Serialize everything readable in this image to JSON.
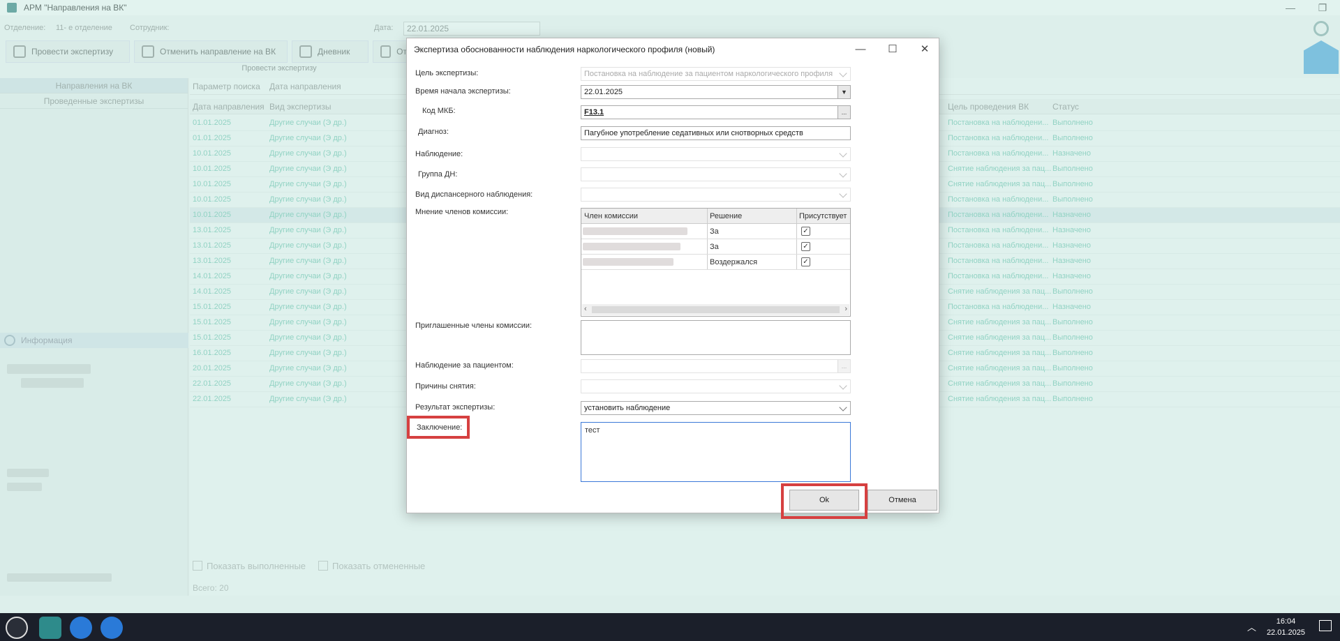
{
  "app": {
    "title": "АРМ \"Направления на ВК\"",
    "dept_label": "Отделение:",
    "dept_value": "11- е отделение",
    "employee_label": "Сотрудник:",
    "date_label": "Дата:",
    "date_value": "22.01.2025"
  },
  "toolbar": {
    "btn1": "Провести экспертизу",
    "btn2": "Отменить направление на ВК",
    "btn3": "Дневник",
    "btn4": "От",
    "caption": "Провести экспертизу"
  },
  "left_panel": {
    "tab1": "Направления на ВК",
    "tab2": "Проведенные экспертизы",
    "info": "Информация"
  },
  "grid": {
    "filter_param": "Параметр поиска",
    "filter_value": "Дата направления",
    "columns": {
      "date": "Дата направления",
      "type": "Вид экспертизы",
      "goal": "Цель проведения ВК",
      "status": "Статус"
    },
    "rows": [
      {
        "date": "01.01.2025",
        "type": "Другие случаи (Э др.)",
        "goal": "Постановка на наблюдени...",
        "status": "Выполнено"
      },
      {
        "date": "01.01.2025",
        "type": "Другие случаи (Э др.)",
        "goal": "Постановка на наблюдени...",
        "status": "Выполнено"
      },
      {
        "date": "10.01.2025",
        "type": "Другие случаи (Э др.)",
        "goal": "Постановка на наблюдени...",
        "status": "Назначено"
      },
      {
        "date": "10.01.2025",
        "type": "Другие случаи (Э др.)",
        "goal": "Снятие наблюдения за пац...",
        "status": "Выполнено"
      },
      {
        "date": "10.01.2025",
        "type": "Другие случаи (Э др.)",
        "goal": "Снятие наблюдения за пац...",
        "status": "Выполнено"
      },
      {
        "date": "10.01.2025",
        "type": "Другие случаи (Э др.)",
        "goal": "Постановка на наблюдени...",
        "status": "Выполнено"
      },
      {
        "date": "10.01.2025",
        "type": "Другие случаи (Э др.)",
        "goal": "Постановка на наблюдени...",
        "status": "Назначено"
      },
      {
        "date": "13.01.2025",
        "type": "Другие случаи (Э др.)",
        "goal": "Постановка на наблюдени...",
        "status": "Назначено"
      },
      {
        "date": "13.01.2025",
        "type": "Другие случаи (Э др.)",
        "goal": "Постановка на наблюдени...",
        "status": "Назначено"
      },
      {
        "date": "13.01.2025",
        "type": "Другие случаи (Э др.)",
        "goal": "Постановка на наблюдени...",
        "status": "Назначено"
      },
      {
        "date": "14.01.2025",
        "type": "Другие случаи (Э др.)",
        "goal": "Постановка на наблюдени...",
        "status": "Назначено"
      },
      {
        "date": "14.01.2025",
        "type": "Другие случаи (Э др.)",
        "goal": "Снятие наблюдения за пац...",
        "status": "Выполнено"
      },
      {
        "date": "15.01.2025",
        "type": "Другие случаи (Э др.)",
        "goal": "Постановка на наблюдени...",
        "status": "Назначено"
      },
      {
        "date": "15.01.2025",
        "type": "Другие случаи (Э др.)",
        "goal": "Снятие наблюдения за пац...",
        "status": "Выполнено"
      },
      {
        "date": "15.01.2025",
        "type": "Другие случаи (Э др.)",
        "goal": "Снятие наблюдения за пац...",
        "status": "Выполнено"
      },
      {
        "date": "16.01.2025",
        "type": "Другие случаи (Э др.)",
        "goal": "Снятие наблюдения за пац...",
        "status": "Выполнено"
      },
      {
        "date": "20.01.2025",
        "type": "Другие случаи (Э др.)",
        "goal": "Снятие наблюдения за пац...",
        "status": "Выполнено"
      },
      {
        "date": "22.01.2025",
        "type": "Другие случаи (Э др.)",
        "goal": "Снятие наблюдения за пац...",
        "status": "Выполнено"
      },
      {
        "date": "22.01.2025",
        "type": "Другие случаи (Э др.)",
        "goal": "Снятие наблюдения за пац...",
        "status": "Выполнено"
      }
    ],
    "show_done": "Показать выполненные",
    "show_cancelled": "Показать отмененные",
    "total_label": "Всего:",
    "total_value": "20"
  },
  "dialog": {
    "title": "Экспертиза обоснованности наблюдения наркологического профиля (новый)",
    "fields": {
      "goal_label": "Цель экспертизы:",
      "goal_value": "Постановка на наблюдение за пациентом наркологического профиля",
      "start_label": "Время начала экспертизы:",
      "start_value": "22.01.2025",
      "mkb_label": "Код МКБ:",
      "mkb_value": "F13.1",
      "diag_label": "Диагноз:",
      "diag_value": "Пагубное употребление седативных или снотворных средств",
      "obs_label": "Наблюдение:",
      "dn_group_label": "Группа ДН:",
      "disp_type_label": "Вид диспансерного наблюдения:",
      "members_label": "Мнение членов комиссии:",
      "invited_label": "Приглашенные члены комиссии:",
      "patient_obs_label": "Наблюдение за пациентом:",
      "removal_label": "Причины снятия:",
      "result_label": "Результат экспертизы:",
      "result_value": "установить наблюдение",
      "conclusion_label": "Заключение:",
      "conclusion_value": "тест"
    },
    "committee": {
      "col_member": "Член комиссии",
      "col_decision": "Решение",
      "col_present": "Присутствует",
      "rows": [
        {
          "decision": "За",
          "present": "✓"
        },
        {
          "decision": "За",
          "present": "✓"
        },
        {
          "decision": "Воздержался",
          "present": "✓"
        }
      ]
    },
    "ok_label": "Ok",
    "cancel_label": "Отмена",
    "browse_label": "..."
  },
  "taskbar": {
    "time": "16:04",
    "date": "22.01.2025"
  }
}
